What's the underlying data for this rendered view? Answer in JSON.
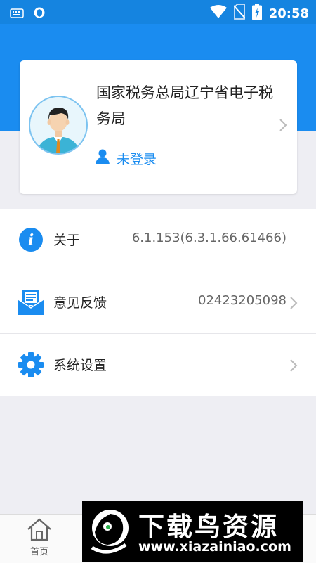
{
  "status_bar": {
    "time": "20:58"
  },
  "profile": {
    "organization": "国家税务总局辽宁省电子税务局",
    "login_status": "未登录"
  },
  "menu": [
    {
      "label": "关于",
      "value": "6.1.153(6.3.1.66.61466)"
    },
    {
      "label": "意见反馈",
      "value": "02423205098"
    },
    {
      "label": "系统设置",
      "value": ""
    }
  ],
  "tabbar": {
    "home_label": "首页"
  },
  "watermark": {
    "title": "下载鸟资源",
    "url": "www.xiazainiao.com"
  },
  "colors": {
    "primary": "#1a8cf0",
    "status_bar": "#1584e0",
    "background": "#eeeef3"
  }
}
